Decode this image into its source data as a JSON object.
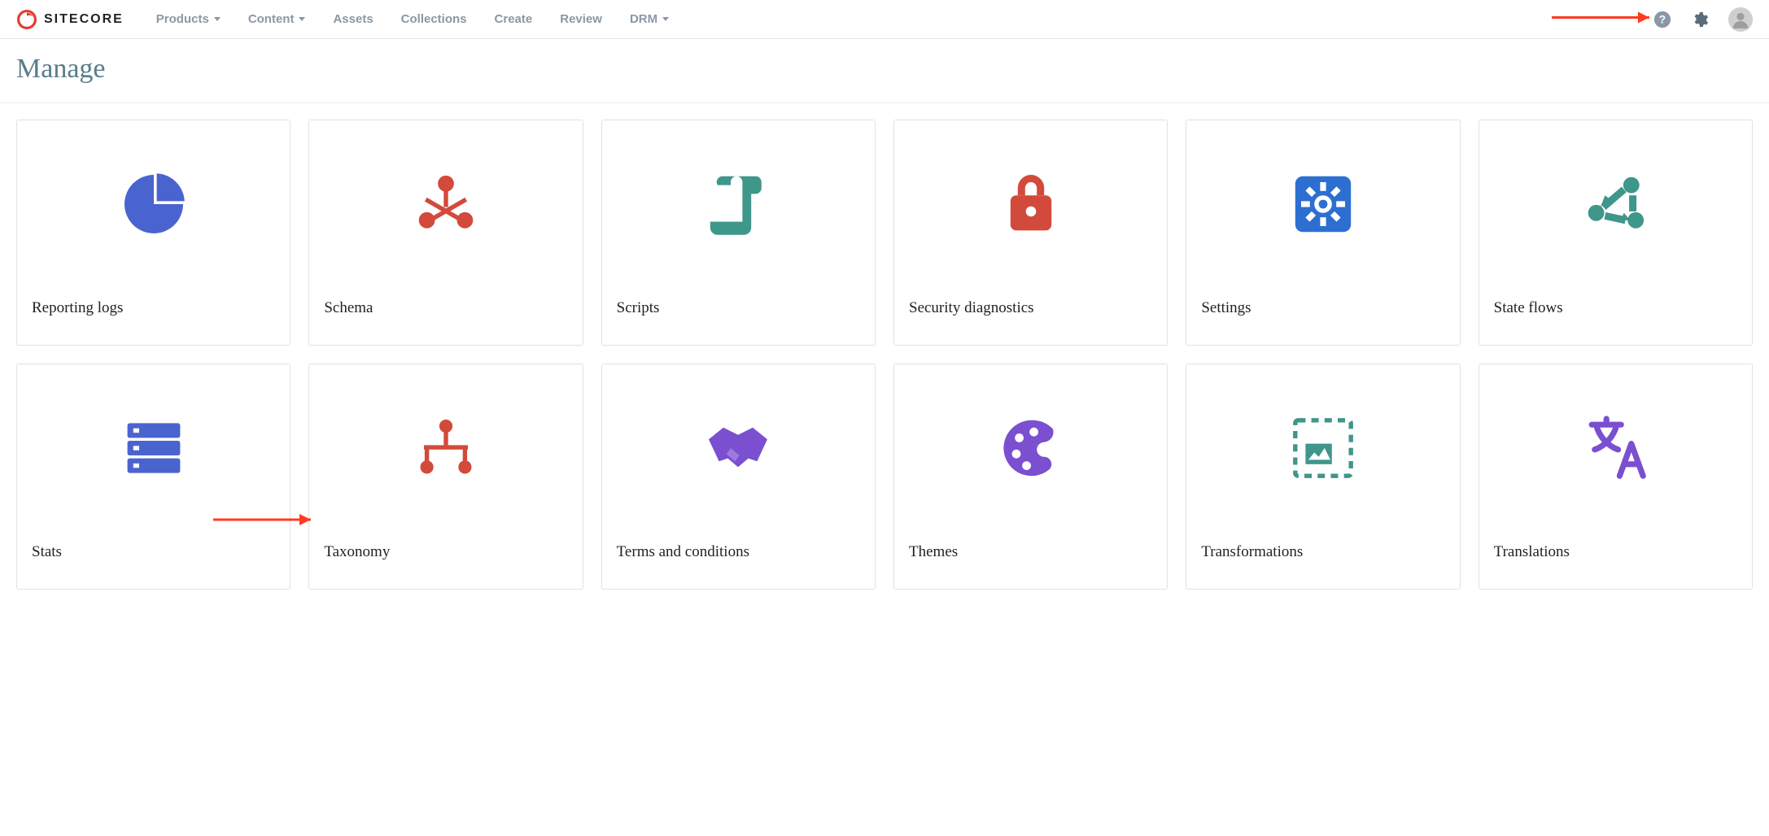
{
  "brand": "SITECORE",
  "nav": [
    {
      "label": "Products",
      "dropdown": true
    },
    {
      "label": "Content",
      "dropdown": true
    },
    {
      "label": "Assets",
      "dropdown": false
    },
    {
      "label": "Collections",
      "dropdown": false
    },
    {
      "label": "Create",
      "dropdown": false
    },
    {
      "label": "Review",
      "dropdown": false
    },
    {
      "label": "DRM",
      "dropdown": true
    }
  ],
  "page_title": "Manage",
  "cards": [
    {
      "label": "Reporting logs",
      "icon": "pie-chart-icon",
      "color": "#4a64cf"
    },
    {
      "label": "Schema",
      "icon": "molecule-icon",
      "color": "#d24a3b"
    },
    {
      "label": "Scripts",
      "icon": "scroll-icon",
      "color": "#3f968a"
    },
    {
      "label": "Security diagnostics",
      "icon": "lock-icon",
      "color": "#d24a3b"
    },
    {
      "label": "Settings",
      "icon": "gear-box-icon",
      "color": "#2c6fd1"
    },
    {
      "label": "State flows",
      "icon": "cycle-icon",
      "color": "#3f968a"
    },
    {
      "label": "Stats",
      "icon": "server-icon",
      "color": "#4a64cf"
    },
    {
      "label": "Taxonomy",
      "icon": "hierarchy-icon",
      "color": "#d24a3b"
    },
    {
      "label": "Terms and conditions",
      "icon": "handshake-icon",
      "color": "#7a4fd0"
    },
    {
      "label": "Themes",
      "icon": "palette-icon",
      "color": "#7a4fd0"
    },
    {
      "label": "Transformations",
      "icon": "image-frame-icon",
      "color": "#3f968a"
    },
    {
      "label": "Translations",
      "icon": "translate-icon",
      "color": "#7a4fd0"
    }
  ]
}
